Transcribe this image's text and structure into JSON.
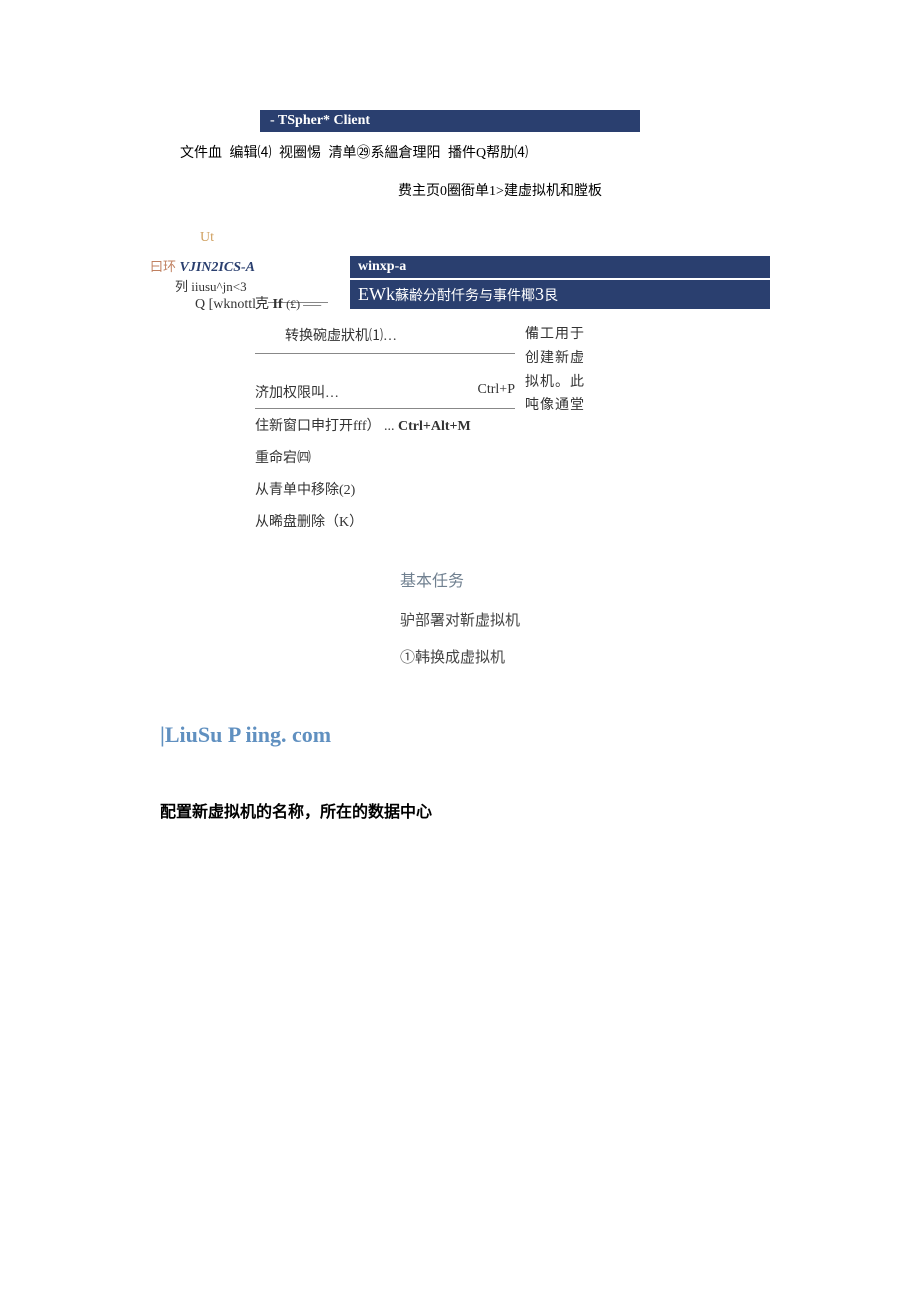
{
  "titleBar": "- TSpher* Client",
  "menuBar": {
    "file": "文件血",
    "edit": "编辑⑷",
    "view": "视圈惕",
    "inventory": "清单㉙系縕倉理阳",
    "plugins": "播件Q帮肋⑷"
  },
  "breadcrumb": "费主页0圈衙单1>建虚拟机和膛板",
  "utLabel": "Ut",
  "tree": {
    "prefix": "曰环",
    "main": "VJIN2ICS-A",
    "sub1prefix": "列",
    "sub1": "iiusu^jn<3",
    "sub2": "Q [wknottl"
  },
  "rightPanel": {
    "winxp": "winxp-a",
    "ewkBig": "EWk",
    "ewkRest3": "3",
    "ewkRest1": "蘇齢分酎仟务与事件椰",
    "ewkRest2": "艮"
  },
  "contextMenu": {
    "clonePrefix": "克",
    "cloneIf": "If",
    "cloneParen": "(£) –––",
    "convert": "转换碗虚狀机⑴…",
    "addPerm": "济加权限叫…",
    "addPermShortcut": "Ctrl+P",
    "openNew": "住新窗口申打开fff）",
    "openNewDots": "...",
    "openNewShortcut": "Ctrl+Alt+M",
    "rename": "重命宕㈣",
    "removeFromList": "从青单中移除(2)",
    "deleteFromDisk": "从晞盘删除（K）"
  },
  "sideText": "備工用于创建新虚拟机。此吨像通堂",
  "basicTasks": {
    "title": "基本任务",
    "item1": "驴部署对靳虚拟机",
    "item2": "①韩换成虚拟机"
  },
  "brand": "|LiuSu P iing. com",
  "configHeading": "配置新虚拟机的名称，所在的数据中心"
}
